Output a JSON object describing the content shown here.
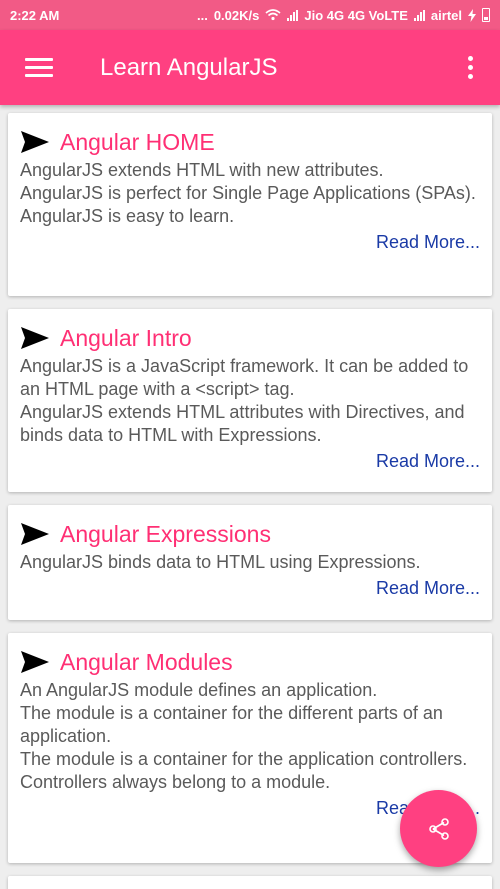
{
  "status_bar": {
    "time": "2:22 AM",
    "dots": "...",
    "speed": "0.02K/s",
    "carrier1": "Jio 4G 4G VoLTE",
    "carrier2": "airtel"
  },
  "app_bar": {
    "title": "Learn AngularJS",
    "menu_icon": "hamburger-menu-icon",
    "overflow_icon": "more-vert-icon"
  },
  "cards": [
    {
      "title": "Angular HOME",
      "description": "AngularJS extends HTML with new attributes.\n AngularJS is perfect for Single Page Applications (SPAs).\n AngularJS is easy to learn.",
      "read_more": "Read More..."
    },
    {
      "title": "Angular Intro",
      "description": "AngularJS is a JavaScript framework. It can be added to an HTML page with a <script> tag.\n AngularJS extends HTML attributes with Directives, and binds data to HTML with Expressions.",
      "read_more": "Read More..."
    },
    {
      "title": "Angular Expressions",
      "description": "AngularJS binds data to HTML using Expressions.",
      "read_more": "Read More..."
    },
    {
      "title": "Angular Modules",
      "description": "An AngularJS module defines an application.\n The module is a container for the different parts of an application.\n The module is a container for the application controllers.\n Controllers always belong to a module.",
      "read_more": "Read More..."
    }
  ],
  "fab": {
    "icon": "share-icon"
  },
  "colors": {
    "status_bar": "#f25a86",
    "app_bar": "#ff4081",
    "title_accent": "#ff2f74",
    "link": "#1a3aa6"
  }
}
